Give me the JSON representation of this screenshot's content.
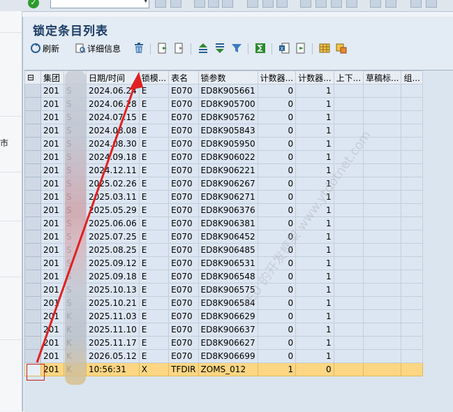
{
  "dialog": {
    "title": "锁定条目列表"
  },
  "toolbar": {
    "refresh_label": "刷新",
    "details_label": "详细信息"
  },
  "grid": {
    "selector_glyph": "⊟",
    "columns": [
      "集团",
      "",
      "日期/时间",
      "锁模...",
      "表名",
      "锁参数",
      "计数器...",
      "计数器...",
      "上下...",
      "草稿标...",
      "组..."
    ],
    "rows": [
      {
        "client": "201",
        "user": "S",
        "date": "2024.06.24",
        "mode": "E",
        "table": "E070",
        "arg": "ED8K905661",
        "c1": "0",
        "c2": "1"
      },
      {
        "client": "201",
        "user": "S",
        "date": "2024.06.28",
        "mode": "E",
        "table": "E070",
        "arg": "ED8K905700",
        "c1": "0",
        "c2": "1"
      },
      {
        "client": "201",
        "user": "S",
        "date": "2024.07.15",
        "mode": "E",
        "table": "E070",
        "arg": "ED8K905762",
        "c1": "0",
        "c2": "1"
      },
      {
        "client": "201",
        "user": "S",
        "date": "2024.08.08",
        "mode": "E",
        "table": "E070",
        "arg": "ED8K905843",
        "c1": "0",
        "c2": "1"
      },
      {
        "client": "201",
        "user": "S",
        "date": "2024.08.30",
        "mode": "E",
        "table": "E070",
        "arg": "ED8K905950",
        "c1": "0",
        "c2": "1"
      },
      {
        "client": "201",
        "user": "S",
        "date": "2024.09.18",
        "mode": "E",
        "table": "E070",
        "arg": "ED8K906022",
        "c1": "0",
        "c2": "1"
      },
      {
        "client": "201",
        "user": "S",
        "date": "2024.12.11",
        "mode": "E",
        "table": "E070",
        "arg": "ED8K906221",
        "c1": "0",
        "c2": "1"
      },
      {
        "client": "201",
        "user": "S",
        "date": "2025.02.26",
        "mode": "E",
        "table": "E070",
        "arg": "ED8K906267",
        "c1": "0",
        "c2": "1"
      },
      {
        "client": "201",
        "user": "S",
        "date": "2025.03.11",
        "mode": "E",
        "table": "E070",
        "arg": "ED8K906271",
        "c1": "0",
        "c2": "1"
      },
      {
        "client": "201",
        "user": "S",
        "date": "2025.05.29",
        "mode": "E",
        "table": "E070",
        "arg": "ED8K906376",
        "c1": "0",
        "c2": "1"
      },
      {
        "client": "201",
        "user": "S",
        "date": "2025.06.06",
        "mode": "E",
        "table": "E070",
        "arg": "ED8K906381",
        "c1": "0",
        "c2": "1"
      },
      {
        "client": "201",
        "user": "S",
        "date": "2025.07.25",
        "mode": "E",
        "table": "E070",
        "arg": "ED8K906452",
        "c1": "0",
        "c2": "1"
      },
      {
        "client": "201",
        "user": "S",
        "date": "2025.08.25",
        "mode": "E",
        "table": "E070",
        "arg": "ED8K906485",
        "c1": "0",
        "c2": "1"
      },
      {
        "client": "201",
        "user": "S",
        "date": "2025.09.12",
        "mode": "E",
        "table": "E070",
        "arg": "ED8K906531",
        "c1": "0",
        "c2": "1"
      },
      {
        "client": "201",
        "user": "S",
        "date": "2025.09.18",
        "mode": "E",
        "table": "E070",
        "arg": "ED8K906548",
        "c1": "0",
        "c2": "1"
      },
      {
        "client": "201",
        "user": "S",
        "date": "2025.10.13",
        "mode": "E",
        "table": "E070",
        "arg": "ED8K906575",
        "c1": "0",
        "c2": "1"
      },
      {
        "client": "201",
        "user": "S",
        "date": "2025.10.21",
        "mode": "E",
        "table": "E070",
        "arg": "ED8K906584",
        "c1": "0",
        "c2": "1"
      },
      {
        "client": "201",
        "user": "K",
        "date": "2025.11.03",
        "mode": "E",
        "table": "E070",
        "arg": "ED8K906629",
        "c1": "0",
        "c2": "1"
      },
      {
        "client": "201",
        "user": "K",
        "date": "2025.11.10",
        "mode": "E",
        "table": "E070",
        "arg": "ED8K906637",
        "c1": "0",
        "c2": "1"
      },
      {
        "client": "201",
        "user": "K",
        "date": "2025.11.17",
        "mode": "E",
        "table": "E070",
        "arg": "ED8K906627",
        "c1": "0",
        "c2": "1"
      },
      {
        "client": "201",
        "user": "K",
        "date": "2026.05.12",
        "mode": "E",
        "table": "E070",
        "arg": "ED8K906699",
        "c1": "0",
        "c2": "1"
      },
      {
        "client": "201",
        "user": "K",
        "date": "10:56:31",
        "mode": "X",
        "table": "TFDIR",
        "arg": "ZOMS_012",
        "c1": "1",
        "c2": "0"
      }
    ],
    "highlight_row_color": "#fcd683"
  },
  "backdrop": {
    "cut_text": "市"
  },
  "watermark": "YEU 的开发框架 www.ytdotnet.com",
  "colors": {
    "title": "#1c3d66",
    "arrow": "#e02020"
  }
}
